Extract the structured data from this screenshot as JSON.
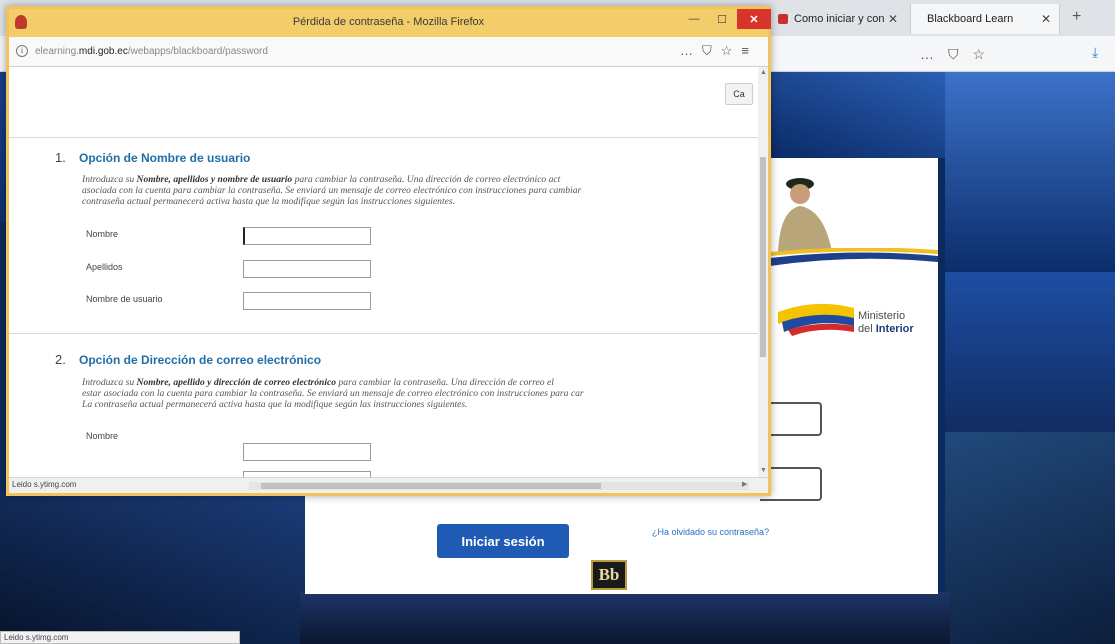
{
  "bg_browser": {
    "tabs": [
      {
        "label": "Como iniciar y con",
        "close": "✕"
      },
      {
        "label": "Blackboard Learn",
        "close": "✕"
      }
    ],
    "new_tab": "+",
    "nav_icons": [
      "…",
      "⛉",
      "☆"
    ],
    "download_icon": "⤓",
    "status": "Leido s.ytimg.com"
  },
  "login": {
    "ministerio_line1": "Ministerio",
    "ministerio_line2_pre": "del ",
    "ministerio_line2_bold": "Interior",
    "submit_label": "Iniciar sesión",
    "forgot_link": "¿Ha olvidado su contraseña?",
    "bb_logo": "Bb"
  },
  "popup": {
    "title": "Pérdida de contraseña - Mozilla Firefox",
    "window_buttons": {
      "minimize": "—",
      "maximize": "☐",
      "close": "✕"
    },
    "url_prefix": "elearning.",
    "url_domain": "mdi.gob.ec",
    "url_path": "/webapps/blackboard/password",
    "url_icons": [
      "…",
      "⛉",
      "☆",
      "≡"
    ],
    "cancel_corner": "Ca",
    "status": "Leido s.ytimg.com",
    "accent": "#f0c45a"
  },
  "form": {
    "section1": {
      "number": "1.",
      "title": "Opción de Nombre de usuario",
      "desc_line1_pre": "Introduzca su ",
      "desc_line1_bold": "Nombre, apellidos y nombre de usuario",
      "desc_line1_post": " para cambiar la contraseña. Una dirección de correo electrónico act",
      "desc_line2": "asociada con la cuenta para cambiar la contraseña. Se enviará un mensaje de correo electrónico con instrucciones para cambiar",
      "desc_line3": "contraseña actual permanecerá activa hasta que la modifique según las instrucciones siguientes.",
      "fields": [
        {
          "label": "Nombre"
        },
        {
          "label": "Apellidos"
        },
        {
          "label": "Nombre de usuario"
        }
      ]
    },
    "section2": {
      "number": "2.",
      "title": "Opción de Dirección de correo electrónico",
      "desc_line1_pre": "Introduzca su ",
      "desc_line1_bold": "Nombre, apellido y dirección de correo electrónico",
      "desc_line1_post": " para cambiar la contraseña. Una dirección de correo el",
      "desc_line2": "estar asociada con la cuenta para cambiar la contraseña. Se enviará un mensaje de correo electrónico con instrucciones para car",
      "desc_line3": "La contraseña actual permanecerá activa hasta que la modifique según las instrucciones siguientes.",
      "fields": [
        {
          "label": "Nombre"
        }
      ]
    }
  }
}
